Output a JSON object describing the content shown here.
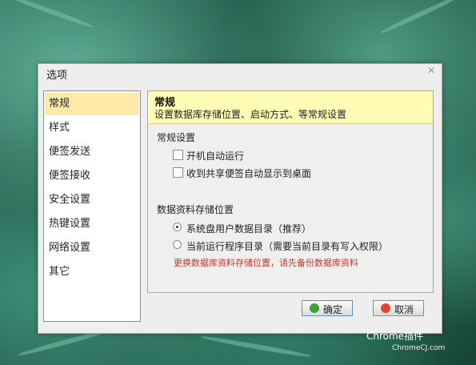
{
  "dialog": {
    "title": "选项"
  },
  "sidebar": {
    "items": [
      {
        "label": "常规",
        "active": true
      },
      {
        "label": "样式"
      },
      {
        "label": "便签发送"
      },
      {
        "label": "便签接收"
      },
      {
        "label": "安全设置"
      },
      {
        "label": "热键设置"
      },
      {
        "label": "网络设置"
      },
      {
        "label": "其它"
      }
    ]
  },
  "panel": {
    "title": "常规",
    "description": "设置数据库存储位置、启动方式、等常规设置",
    "section_general": "常规设置",
    "checkbox_autostart": "开机自动运行",
    "checkbox_show_received": "收到共享便签自动显示到桌面",
    "section_storage": "数据资料存储位置",
    "radio_system_dir": "系统盘用户数据目录（推荐）",
    "radio_program_dir": "当前运行程序目录（需要当前目录有写入权限）",
    "warning": "更换数据库资料存储位置，请先备份数据库资料"
  },
  "buttons": {
    "ok": "确定",
    "cancel": "取消"
  },
  "watermark": {
    "brand": "Chrome插件",
    "site": "ChromeCJ.com"
  },
  "colors": {
    "active_item": "#ffe9a8",
    "header_bg": "#fffdb5",
    "warning": "#c0392b"
  }
}
